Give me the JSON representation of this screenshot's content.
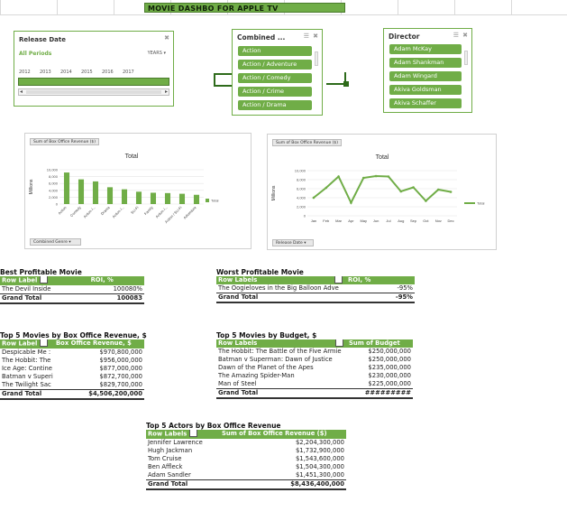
{
  "dashboard_title": "MOVIE DASHBO FOR APPLE TV",
  "timeline": {
    "title": "Release Date",
    "period": "All Periods",
    "unit": "YEARS",
    "years": [
      "2012",
      "2013",
      "2014",
      "2015",
      "2016",
      "2017"
    ]
  },
  "slicer_genre": {
    "title": "Combined ...",
    "items": [
      "Action",
      "Action / Adventure",
      "Action / Comedy",
      "Action / Crime",
      "Action / Drama"
    ]
  },
  "slicer_director": {
    "title": "Director",
    "items": [
      "Adam McKay",
      "Adam Shankman",
      "Adam Wingard",
      "Akiva Goldsman",
      "Akiva Schaffer"
    ]
  },
  "chart1": {
    "field_label": "Sum of Box Office Revenue ($)",
    "filter_chip": "Combined Genre",
    "legend": "Total"
  },
  "chart2": {
    "field_label": "Sum of Box Office Revenue ($)",
    "filter_chip": "Release Date",
    "legend": "Total"
  },
  "chart_data": [
    {
      "type": "bar",
      "title": "Total",
      "ylabel": "Millions",
      "ylim": [
        0,
        10000
      ],
      "yticks": [
        "0",
        "2,000",
        "4,000",
        "6,000",
        "8,000",
        "10,000"
      ],
      "categories": [
        "Action",
        "Comedy",
        "Action /...",
        "Drama",
        "Action /...",
        "Sci-Fi",
        "Family",
        "Action /...",
        "Action / Sci-Fi",
        "Adventure"
      ],
      "series": [
        {
          "name": "Total",
          "values": [
            9200,
            7200,
            6600,
            4900,
            4300,
            3600,
            3300,
            3200,
            3000,
            2700
          ]
        }
      ],
      "legend": "right",
      "grid": true
    },
    {
      "type": "line",
      "title": "Total",
      "ylabel": "Millions",
      "ylim": [
        0,
        10000
      ],
      "yticks": [
        "0",
        "2,000",
        "4,000",
        "6,000",
        "8,000",
        "10,000"
      ],
      "categories": [
        "Jan",
        "Feb",
        "Mar",
        "Apr",
        "May",
        "Jun",
        "Jul",
        "Aug",
        "Sep",
        "Oct",
        "Nov",
        "Dec"
      ],
      "series": [
        {
          "name": "Total",
          "values": [
            4000,
            6200,
            8700,
            2900,
            8400,
            8800,
            8700,
            5400,
            6300,
            3300,
            5800,
            5300
          ]
        }
      ],
      "legend": "right",
      "grid": true
    }
  ],
  "best_profitable": {
    "title": "Best Profitable Movie",
    "headers": [
      "Row Label",
      "ROI, %"
    ],
    "rows": [
      [
        "The Devil Inside",
        "100080%"
      ]
    ],
    "total": [
      "Grand Total",
      "100083"
    ]
  },
  "worst_profitable": {
    "title": "Worst Profitable Movie",
    "headers": [
      "Row Labels",
      "ROI, %"
    ],
    "rows": [
      [
        "The Oogieloves in the Big Balloon Adve",
        "-95%"
      ]
    ],
    "total": [
      "Grand Total",
      "-95%"
    ]
  },
  "top5_revenue": {
    "title": "Top 5 Movies by Box Office Revenue, $",
    "headers": [
      "Row Label",
      "Box Office Revenue, $"
    ],
    "rows": [
      [
        "Despicable Me :",
        "$970,800,000"
      ],
      [
        "The Hobbit: The",
        "$956,000,000"
      ],
      [
        "Ice Age: Contine",
        "$877,000,000"
      ],
      [
        "Batman v Superi",
        "$872,700,000"
      ],
      [
        "The Twilight Sac",
        "$829,700,000"
      ]
    ],
    "total": [
      "Grand Total",
      "$4,506,200,000"
    ]
  },
  "top5_budget": {
    "title": "Top 5 Movies by Budget, $",
    "headers": [
      "Row Labels",
      "Sum of Budget"
    ],
    "rows": [
      [
        "The Hobbit: The Battle of the Five Armie",
        "$250,000,000"
      ],
      [
        "Batman v Superman: Dawn of Justice",
        "$250,000,000"
      ],
      [
        "Dawn of the Planet of the Apes",
        "$235,000,000"
      ],
      [
        "The Amazing Spider-Man",
        "$230,000,000"
      ],
      [
        "Man of Steel",
        "$225,000,000"
      ]
    ],
    "total": [
      "Grand Total",
      "#########"
    ]
  },
  "top5_actors": {
    "title": "Top 5 Actors by Box Office Revenue",
    "headers": [
      "Row Labels",
      "Sum of Box Office Revenue ($)"
    ],
    "rows": [
      [
        "Jennifer Lawrence",
        "$2,204,300,000"
      ],
      [
        "Hugh Jackman",
        "$1,732,900,000"
      ],
      [
        "Tom Cruise",
        "$1,543,600,000"
      ],
      [
        "Ben Affleck",
        "$1,504,300,000"
      ],
      [
        "Adam Sandler",
        "$1,451,300,000"
      ]
    ],
    "total": [
      "Grand Total",
      "$8,436,400,000"
    ]
  },
  "colors": {
    "accent": "#70ad47",
    "dark_accent": "#2e6b1b"
  }
}
